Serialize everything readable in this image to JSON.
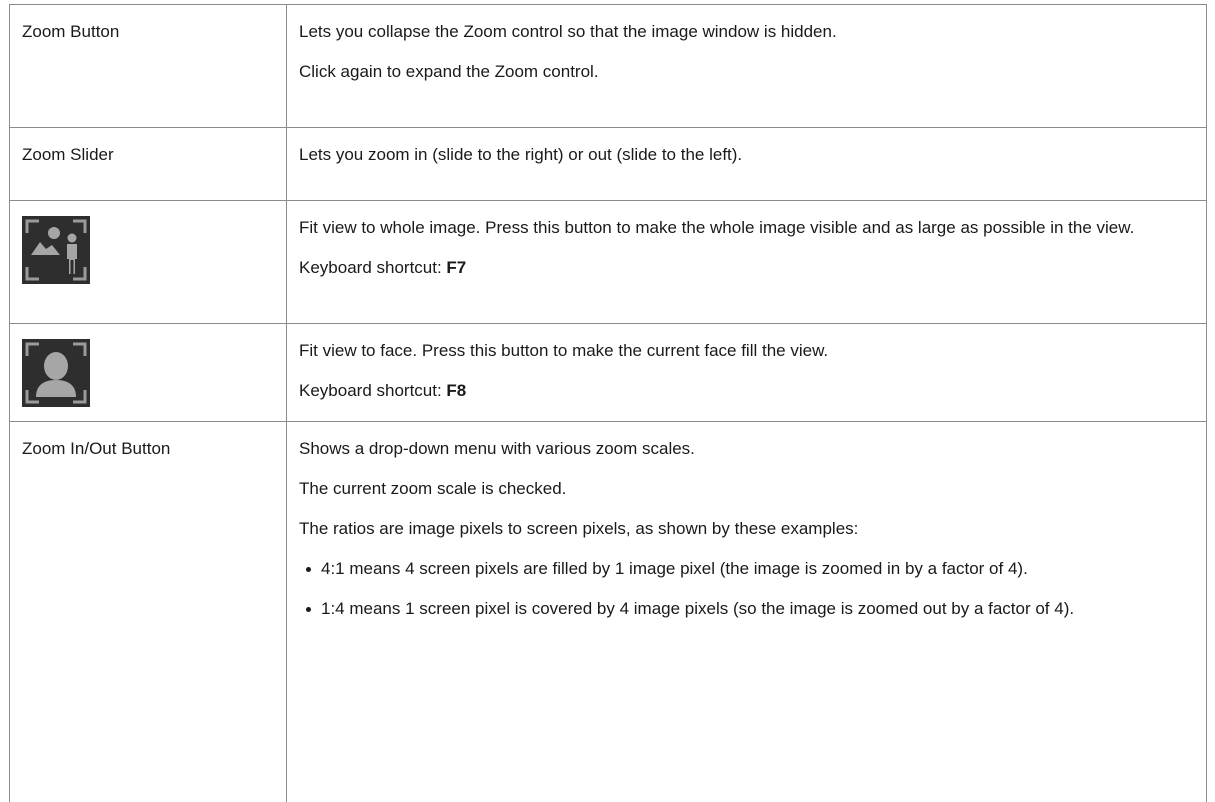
{
  "rows": [
    {
      "label": "Zoom Button",
      "paragraphs": [
        "Lets you collapse the Zoom control so that the image window is hidden.",
        "Click again to expand the Zoom control."
      ]
    },
    {
      "label": "Zoom Slider",
      "paragraphs": [
        "Lets you zoom in (slide to the right) or out (slide to the left)."
      ]
    },
    {
      "icon": "fit-whole-image-icon",
      "paragraphs": [
        "Fit view to whole image.  Press this button to make the whole image visible and as large as possible in the view."
      ],
      "shortcut_prefix": "Keyboard shortcut: ",
      "shortcut_key": "F7"
    },
    {
      "icon": "fit-face-icon",
      "paragraphs": [
        "Fit view to face.  Press this button to make the current face fill the view."
      ],
      "shortcut_prefix": "Keyboard shortcut: ",
      "shortcut_key": "F8"
    },
    {
      "label": "Zoom In/Out Button",
      "paragraphs": [
        "Shows a drop-down menu with various zoom scales.",
        "The current zoom scale is checked.",
        "The ratios are image pixels to screen pixels, as shown by these examples:"
      ],
      "bullets": [
        "4:1 means 4 screen pixels are filled by 1 image pixel (the image is zoomed in by a factor of 4).",
        "1:4 means 1 screen pixel is covered by 4 image pixels (so the image is zoomed out by a factor of 4)."
      ]
    }
  ],
  "colors": {
    "border": "#8c8c8c",
    "icon_bg": "#2e2e2e",
    "icon_fg": "#9a9a9a",
    "text": "#1a1a1a"
  }
}
